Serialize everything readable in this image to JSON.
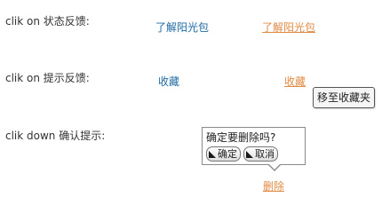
{
  "rows": [
    {
      "label": "clik  on 状态反馈:",
      "link_default": "了解阳光包",
      "link_hover": "了解阳光包"
    },
    {
      "label": "clik  on 提示反馈:",
      "link_default": "收藏",
      "link_hover": "收藏",
      "tooltip": "移至收藏夹"
    },
    {
      "label": "clik down 确认提示:",
      "confirm_question": "确定要删除吗?",
      "confirm_ok": "确定",
      "confirm_cancel": "取消",
      "link_hover": "删除"
    }
  ],
  "colors": {
    "link_default": "#1e6aa3",
    "link_hover": "#e08b45"
  },
  "icons": {
    "button_icon": "triangle-corner-icon"
  }
}
